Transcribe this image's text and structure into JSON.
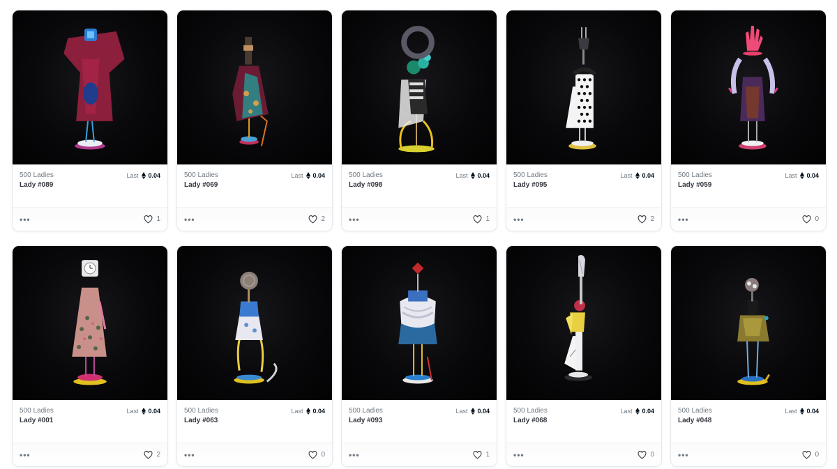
{
  "colors": {
    "accent_text": "#04111d",
    "muted_text": "#707a83",
    "card_border": "#e5e8eb",
    "media_bg": "#0a0a0c"
  },
  "icons": {
    "price_currency": "eth-icon",
    "favorite": "heart-outline-icon",
    "more": "more-options-icon"
  },
  "items": [
    {
      "collection": "500 Ladies",
      "name": "Lady #089",
      "price_label": "Last",
      "price": "0.04",
      "likes": "1"
    },
    {
      "collection": "500 Ladies",
      "name": "Lady #069",
      "price_label": "Last",
      "price": "0.04",
      "likes": "2"
    },
    {
      "collection": "500 Ladies",
      "name": "Lady #098",
      "price_label": "Last",
      "price": "0.04",
      "likes": "1"
    },
    {
      "collection": "500 Ladies",
      "name": "Lady #095",
      "price_label": "Last",
      "price": "0.04",
      "likes": "2"
    },
    {
      "collection": "500 Ladies",
      "name": "Lady #059",
      "price_label": "Last",
      "price": "0.04",
      "likes": "0"
    },
    {
      "collection": "500 Ladies",
      "name": "Lady #001",
      "price_label": "Last",
      "price": "0.04",
      "likes": "2"
    },
    {
      "collection": "500 Ladies",
      "name": "Lady #063",
      "price_label": "Last",
      "price": "0.04",
      "likes": "0"
    },
    {
      "collection": "500 Ladies",
      "name": "Lady #093",
      "price_label": "Last",
      "price": "0.04",
      "likes": "1"
    },
    {
      "collection": "500 Ladies",
      "name": "Lady #068",
      "price_label": "Last",
      "price": "0.04",
      "likes": "0"
    },
    {
      "collection": "500 Ladies",
      "name": "Lady #048",
      "price_label": "Last",
      "price": "0.04",
      "likes": "0"
    }
  ]
}
